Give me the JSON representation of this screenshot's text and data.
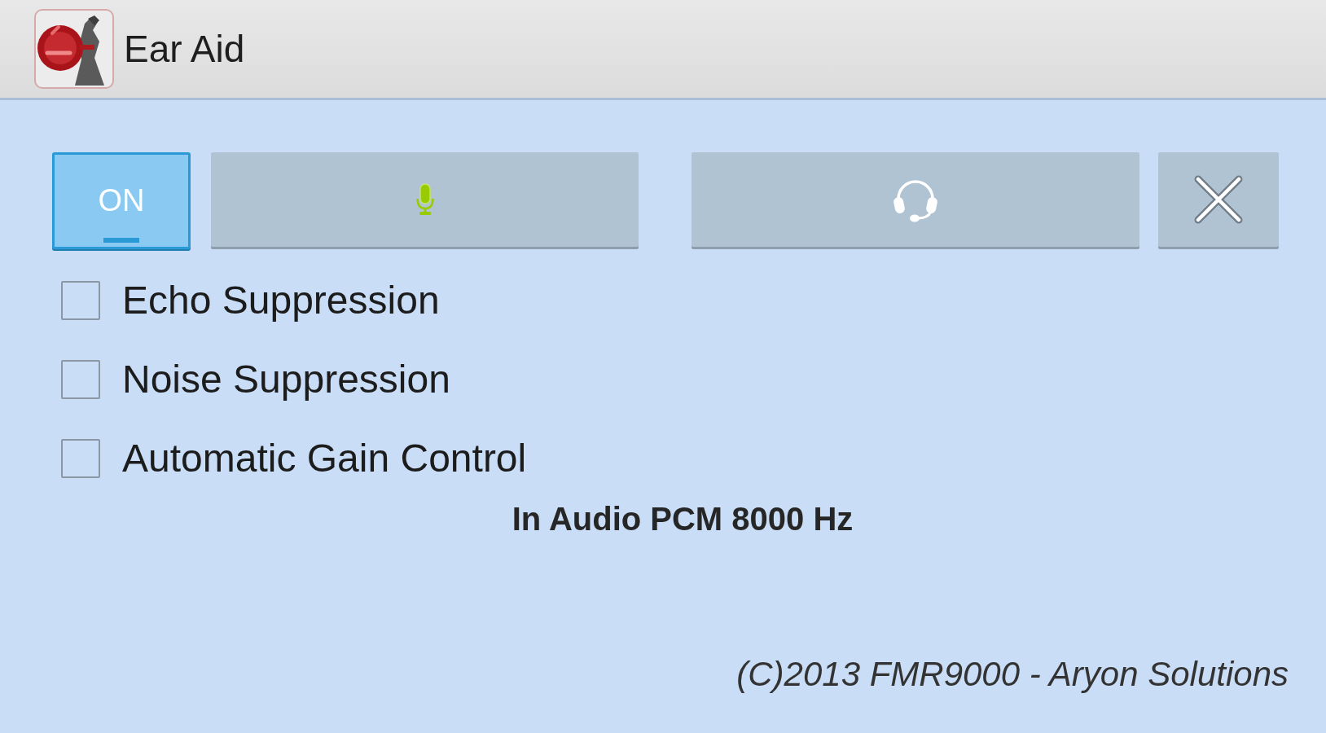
{
  "title_bar": {
    "title": "Ear Aid"
  },
  "toolbar": {
    "power_toggle": {
      "label": "ON",
      "on": true
    }
  },
  "options": [
    {
      "label": "Echo Suppression",
      "checked": false
    },
    {
      "label": "Noise Suppression",
      "checked": false
    },
    {
      "label": "Automatic Gain Control",
      "checked": false
    }
  ],
  "status": "In Audio PCM 8000 Hz",
  "footer": "(C)2013 FMR9000 - Aryon Solutions"
}
